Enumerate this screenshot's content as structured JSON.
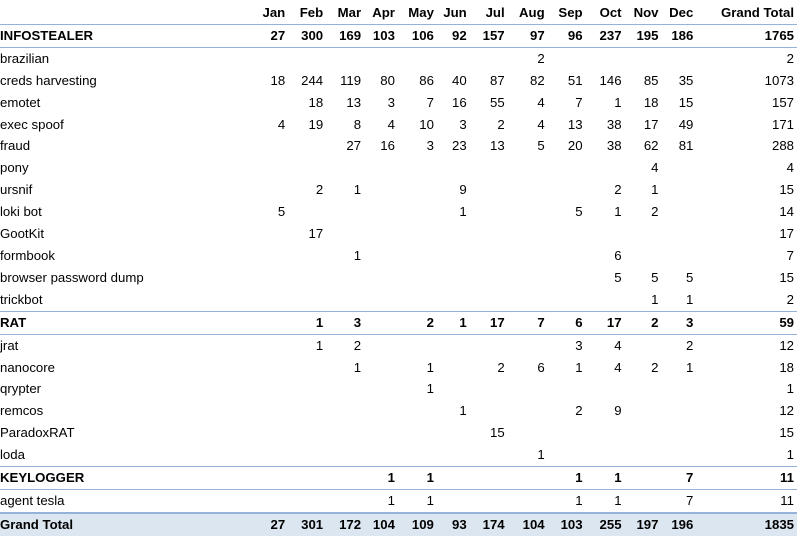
{
  "table": {
    "corner_label": "",
    "months": [
      "Jan",
      "Feb",
      "Mar",
      "Apr",
      "May",
      "Jun",
      "Jul",
      "Aug",
      "Sep",
      "Oct",
      "Nov",
      "Dec"
    ],
    "grand_total_label": "Grand Total",
    "rows": [
      {
        "kind": "group",
        "label": "INFOSTEALER",
        "values": [
          "27",
          "300",
          "169",
          "103",
          "106",
          "92",
          "157",
          "97",
          "96",
          "237",
          "195",
          "186"
        ],
        "total": "1765"
      },
      {
        "kind": "item",
        "label": "brazilian",
        "values": [
          "",
          "",
          "",
          "",
          "",
          "",
          "",
          "2",
          "",
          "",
          "",
          ""
        ],
        "total": "2"
      },
      {
        "kind": "item",
        "label": "creds harvesting",
        "values": [
          "18",
          "244",
          "119",
          "80",
          "86",
          "40",
          "87",
          "82",
          "51",
          "146",
          "85",
          "35"
        ],
        "total": "1073"
      },
      {
        "kind": "item",
        "label": "emotet",
        "values": [
          "",
          "18",
          "13",
          "3",
          "7",
          "16",
          "55",
          "4",
          "7",
          "1",
          "18",
          "15"
        ],
        "total": "157"
      },
      {
        "kind": "item",
        "label": "exec spoof",
        "values": [
          "4",
          "19",
          "8",
          "4",
          "10",
          "3",
          "2",
          "4",
          "13",
          "38",
          "17",
          "49"
        ],
        "total": "171"
      },
      {
        "kind": "item",
        "label": "fraud",
        "values": [
          "",
          "",
          "27",
          "16",
          "3",
          "23",
          "13",
          "5",
          "20",
          "38",
          "62",
          "81"
        ],
        "total": "288"
      },
      {
        "kind": "item",
        "label": "pony",
        "values": [
          "",
          "",
          "",
          "",
          "",
          "",
          "",
          "",
          "",
          "",
          "4",
          ""
        ],
        "total": "4"
      },
      {
        "kind": "item",
        "label": "ursnif",
        "values": [
          "",
          "2",
          "1",
          "",
          "",
          "9",
          "",
          "",
          "",
          "2",
          "1",
          ""
        ],
        "total": "15"
      },
      {
        "kind": "item",
        "label": "loki bot",
        "values": [
          "5",
          "",
          "",
          "",
          "",
          "1",
          "",
          "",
          "5",
          "1",
          "2",
          ""
        ],
        "total": "14"
      },
      {
        "kind": "item",
        "label": "GootKit",
        "values": [
          "",
          "17",
          "",
          "",
          "",
          "",
          "",
          "",
          "",
          "",
          "",
          ""
        ],
        "total": "17"
      },
      {
        "kind": "item",
        "label": "formbook",
        "values": [
          "",
          "",
          "1",
          "",
          "",
          "",
          "",
          "",
          "",
          "6",
          "",
          ""
        ],
        "total": "7"
      },
      {
        "kind": "item",
        "label": "browser password dump",
        "values": [
          "",
          "",
          "",
          "",
          "",
          "",
          "",
          "",
          "",
          "5",
          "5",
          "5"
        ],
        "total": "15"
      },
      {
        "kind": "item",
        "label": "trickbot",
        "values": [
          "",
          "",
          "",
          "",
          "",
          "",
          "",
          "",
          "",
          "",
          "1",
          "1"
        ],
        "total": "2"
      },
      {
        "kind": "group",
        "label": "RAT",
        "values": [
          "",
          "1",
          "3",
          "",
          "2",
          "1",
          "17",
          "7",
          "6",
          "17",
          "2",
          "3"
        ],
        "total": "59"
      },
      {
        "kind": "item",
        "label": "jrat",
        "values": [
          "",
          "1",
          "2",
          "",
          "",
          "",
          "",
          "",
          "3",
          "4",
          "",
          "2"
        ],
        "total": "12"
      },
      {
        "kind": "item",
        "label": "nanocore",
        "values": [
          "",
          "",
          "1",
          "",
          "1",
          "",
          "2",
          "6",
          "1",
          "4",
          "2",
          "1"
        ],
        "total": "18"
      },
      {
        "kind": "item",
        "label": "qrypter",
        "values": [
          "",
          "",
          "",
          "",
          "1",
          "",
          "",
          "",
          "",
          "",
          "",
          ""
        ],
        "total": "1"
      },
      {
        "kind": "item",
        "label": "remcos",
        "values": [
          "",
          "",
          "",
          "",
          "",
          "1",
          "",
          "",
          "2",
          "9",
          "",
          ""
        ],
        "total": "12"
      },
      {
        "kind": "item",
        "label": "ParadoxRAT",
        "values": [
          "",
          "",
          "",
          "",
          "",
          "",
          "15",
          "",
          "",
          "",
          "",
          ""
        ],
        "total": "15"
      },
      {
        "kind": "item",
        "label": "loda",
        "values": [
          "",
          "",
          "",
          "",
          "",
          "",
          "",
          "1",
          "",
          "",
          "",
          ""
        ],
        "total": "1"
      },
      {
        "kind": "group",
        "label": "KEYLOGGER",
        "values": [
          "",
          "",
          "",
          "1",
          "1",
          "",
          "",
          "",
          "1",
          "1",
          "",
          "7"
        ],
        "total": "11"
      },
      {
        "kind": "item",
        "label": "agent tesla",
        "values": [
          "",
          "",
          "",
          "1",
          "1",
          "",
          "",
          "",
          "1",
          "1",
          "",
          "7"
        ],
        "total": "11"
      },
      {
        "kind": "total",
        "label": "Grand Total",
        "values": [
          "27",
          "301",
          "172",
          "104",
          "109",
          "93",
          "174",
          "104",
          "103",
          "255",
          "197",
          "196"
        ],
        "total": "1835"
      }
    ]
  }
}
